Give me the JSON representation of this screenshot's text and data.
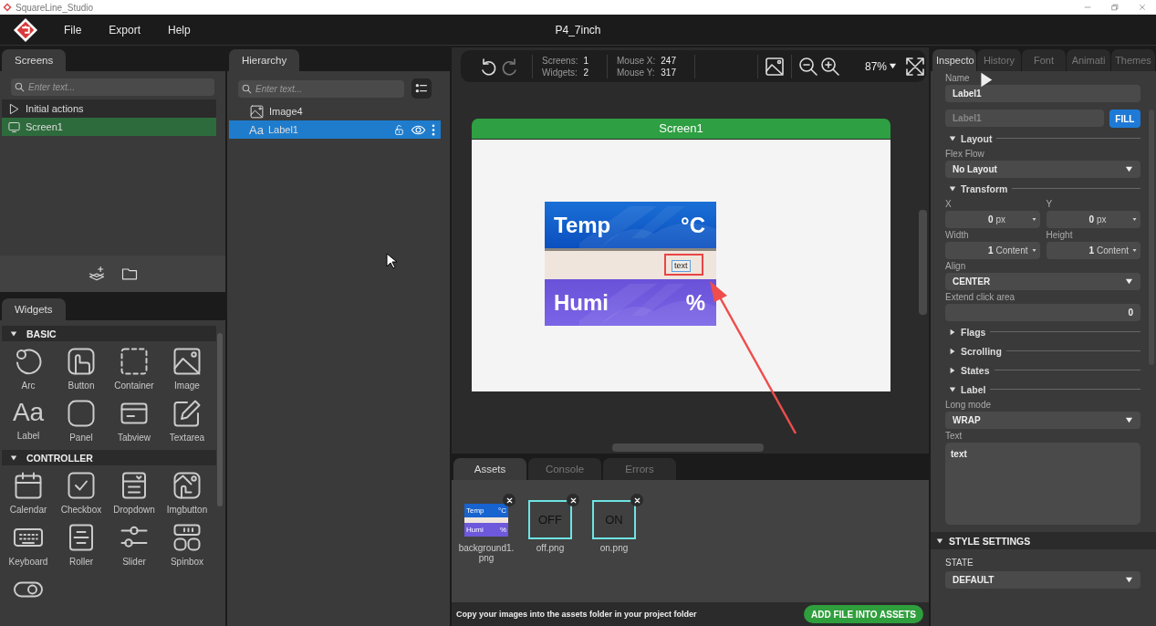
{
  "titlebar": {
    "title": "SquareLine_Studio"
  },
  "menu": [
    {
      "label": "File"
    },
    {
      "label": "Export"
    },
    {
      "label": "Help"
    }
  ],
  "project_title": "P4_7inch",
  "screens_panel": {
    "tab": "Screens",
    "search": {
      "placeholder": "Enter text..."
    },
    "items": [
      {
        "label": "Initial actions",
        "kind": "actions",
        "selected": false
      },
      {
        "label": "Screen1",
        "kind": "screen",
        "selected": true
      }
    ]
  },
  "hierarchy_panel": {
    "tab": "Hierarchy",
    "search": {
      "placeholder": "Enter text..."
    },
    "items": [
      {
        "label": "Image4",
        "kind": "image",
        "selected": false
      },
      {
        "label": "Label1",
        "kind": "label",
        "glyph": "Aa",
        "selected": true
      }
    ]
  },
  "widgets_panel": {
    "tab": "Widgets",
    "groups": [
      {
        "title": "BASIC",
        "expanded": true,
        "items": [
          {
            "label": "Arc",
            "kind": "arc"
          },
          {
            "label": "Button",
            "kind": "button"
          },
          {
            "label": "Container",
            "kind": "container"
          },
          {
            "label": "Image",
            "kind": "image"
          },
          {
            "label": "Label",
            "kind": "label",
            "glyph": "Aa"
          },
          {
            "label": "Panel",
            "kind": "panel"
          },
          {
            "label": "Tabview",
            "kind": "tabview"
          },
          {
            "label": "Textarea",
            "kind": "textarea"
          }
        ]
      },
      {
        "title": "CONTROLLER",
        "expanded": true,
        "items": [
          {
            "label": "Calendar",
            "kind": "calendar"
          },
          {
            "label": "Checkbox",
            "kind": "checkbox"
          },
          {
            "label": "Dropdown",
            "kind": "dropdown"
          },
          {
            "label": "Imgbutton",
            "kind": "imgbutton"
          },
          {
            "label": "Keyboard",
            "kind": "keyboard"
          },
          {
            "label": "Roller",
            "kind": "roller"
          },
          {
            "label": "Slider",
            "kind": "slider"
          },
          {
            "label": "Spinbox",
            "kind": "spinbox"
          },
          {
            "kind": "switch"
          }
        ]
      }
    ]
  },
  "toolbar": {
    "stats": [
      [
        {
          "label": "Screens:",
          "value": "1"
        },
        {
          "label": "Widgets:",
          "value": "2"
        }
      ],
      [
        {
          "label": "Mouse X:",
          "value": "247"
        },
        {
          "label": "Mouse Y:",
          "value": "317"
        }
      ]
    ],
    "zoom": "87%"
  },
  "canvas": {
    "screen_title": "Screen1",
    "image_rows": [
      {
        "label": "Temp",
        "unit": "°C",
        "kind": "temp"
      },
      {
        "label": "Humi",
        "unit": "%",
        "kind": "humi"
      }
    ],
    "label_text": "text"
  },
  "bottom_panel": {
    "tabs": [
      {
        "label": "Assets",
        "selected": true
      },
      {
        "label": "Console",
        "selected": false
      },
      {
        "label": "Errors",
        "selected": false
      }
    ],
    "assets": [
      {
        "name": "background1.png",
        "kind": "background",
        "texts": [
          "Temp",
          "°C",
          "Humi",
          "%"
        ]
      },
      {
        "name": "off.png",
        "kind": "caption",
        "caption": "OFF"
      },
      {
        "name": "on.png",
        "kind": "caption",
        "caption": "ON"
      }
    ],
    "hint": "Copy your images into the assets folder in your project folder",
    "add_button": "ADD FILE INTO ASSETS"
  },
  "inspector": {
    "tabs": [
      {
        "label": "Inspecto",
        "selected": true
      },
      {
        "label": "History",
        "selected": false
      },
      {
        "label": "Font",
        "selected": false
      },
      {
        "label": "Animati",
        "selected": false
      },
      {
        "label": "Themes",
        "selected": false
      }
    ],
    "items": [
      {
        "kind": "field",
        "label": "Name",
        "value": "Label1"
      },
      {
        "kind": "field_button",
        "placeholder": "Label1",
        "button": "FILL"
      },
      {
        "kind": "section",
        "title": "Layout",
        "expanded": true
      },
      {
        "kind": "dropdown",
        "label": "Flex Flow",
        "value": "No Layout"
      },
      {
        "kind": "section",
        "title": "Transform",
        "expanded": true
      },
      {
        "kind": "pair",
        "fields": [
          {
            "label": "X",
            "value": "0",
            "unit": "px"
          },
          {
            "label": "Y",
            "value": "0",
            "unit": "px"
          }
        ]
      },
      {
        "kind": "pair",
        "fields": [
          {
            "label": "Width",
            "value": "1",
            "unit": "Content"
          },
          {
            "label": "Height",
            "value": "1",
            "unit": "Content"
          }
        ]
      },
      {
        "kind": "dropdown",
        "label": "Align",
        "value": "CENTER"
      },
      {
        "kind": "number",
        "label": "Extend click area",
        "value": "0"
      },
      {
        "kind": "section",
        "title": "Flags",
        "expanded": false
      },
      {
        "kind": "section",
        "title": "Scrolling",
        "expanded": false
      },
      {
        "kind": "section",
        "title": "States",
        "expanded": false
      },
      {
        "kind": "section",
        "title": "Label",
        "expanded": true
      },
      {
        "kind": "dropdown",
        "label": "Long mode",
        "value": "WRAP"
      },
      {
        "kind": "textarea",
        "label": "Text",
        "value": "text"
      }
    ],
    "style_settings": {
      "title": "STYLE SETTINGS",
      "expanded": true,
      "state_label": "STATE",
      "state_value": "DEFAULT"
    }
  }
}
